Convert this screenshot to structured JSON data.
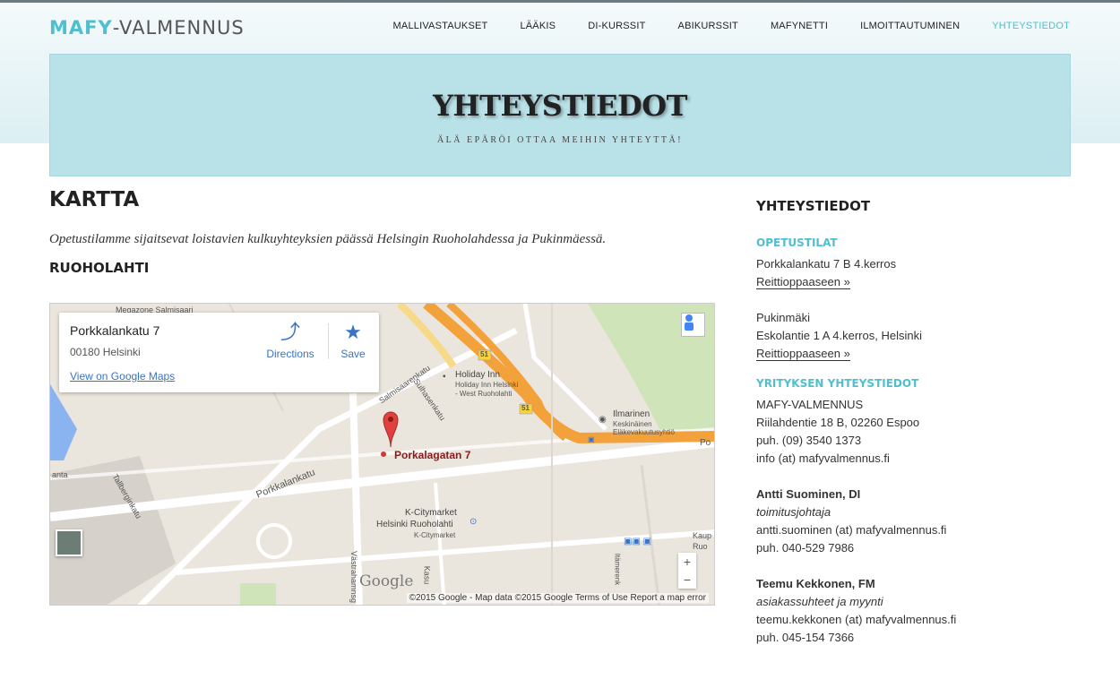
{
  "header": {
    "logo_main": "MAFY",
    "logo_rest": "-VALMENNUS",
    "nav": [
      "MALLIVASTAUKSET",
      "LÄÄKIS",
      "DI-KURSSIT",
      "ABIKURSSIT",
      "MAFYNETTI",
      "ILMOITTAUTUMINEN",
      "YHTEYSTIEDOT"
    ],
    "active": "YHTEYSTIEDOT"
  },
  "hero": {
    "title": "YHTEYSTIEDOT",
    "subtitle": "ÄLÄ EPÄRÖI OTTAA MEIHIN YHTEYTTÄ!"
  },
  "main": {
    "title": "KARTTA",
    "intro": "Opetustilamme sijaitsevat loistavien kulkuyhteyksien päässä Helsingin Ruoholahdessa ja Pukinmäessä.",
    "section": "RUOHOLAHTI"
  },
  "map": {
    "info_address": "Porkkalankatu 7",
    "info_zip": "00180 Helsinki",
    "view_link": "View on Google Maps",
    "directions": "Directions",
    "save": "Save",
    "pin_label": "Porkalagatan 7",
    "labels": [
      "Megazone Salmisaari",
      "Salmisaarenkatu",
      "Sulhasenkatu",
      "Holiday Inn",
      "Holiday Inn Helsinki",
      "- West Ruoholahti",
      "Ilmarinen",
      "Keskinäinen",
      "Eläkevakuutusyhtiö",
      "K-Citymarket",
      "Helsinki Ruoholahti",
      "K-Citymarket",
      "Porkkalankatu",
      "Tallberginkatu",
      "Västrahamnsg",
      "Kasu",
      "Itämerenk",
      "Po",
      "Kaup",
      "Ruo",
      "anta",
      "51",
      "51"
    ],
    "zoom_in": "+",
    "zoom_out": "−",
    "google": "Google",
    "attribution": "©2015 Google - Map data ©2015 Google    Terms of Use    Report a map error"
  },
  "sidebar": {
    "title": "YHTEYSTIEDOT",
    "opetustilat_heading": "OPETUSTILAT",
    "loc1_line1": "Porkkalankatu 7 B 4.kerros",
    "loc1_link": "Reittioppaaseen »",
    "loc2_line1": "Pukinmäki",
    "loc2_line2": "Eskolantie 1 A 4.kerros, Helsinki",
    "loc2_link": "Reittioppaaseen »",
    "company_heading": "YRITYKSEN YHTEYSTIEDOT",
    "company_name": "MAFY-VALMENNUS",
    "company_address": "Riilahdentie 18 B, 02260 Espoo",
    "company_phone": "puh. (09) 3540 1373",
    "company_email": "info (at) mafyvalmennus.fi",
    "p1_name": "Antti Suominen, DI",
    "p1_role": "toimitusjohtaja",
    "p1_email": "antti.suominen (at) mafyvalmennus.fi",
    "p1_phone": "puh. 040-529 7986",
    "p2_name": "Teemu Kekkonen, FM",
    "p2_role": "asiakassuhteet ja myynti",
    "p2_email": "teemu.kekkonen (at) mafyvalmennus.fi",
    "p2_phone": "puh. 045-154 7366"
  },
  "colors": {
    "accent": "#4fbfcf",
    "hero_bg": "#b9e1e8",
    "map_road_major": "#f3a13b",
    "map_bg": "#ebe6dd"
  },
  "icons": [
    "directions-icon",
    "star-icon",
    "pegman-icon",
    "map-pin-icon",
    "shopping-cart-icon",
    "hotel-icon",
    "bus-stop-icon"
  ]
}
